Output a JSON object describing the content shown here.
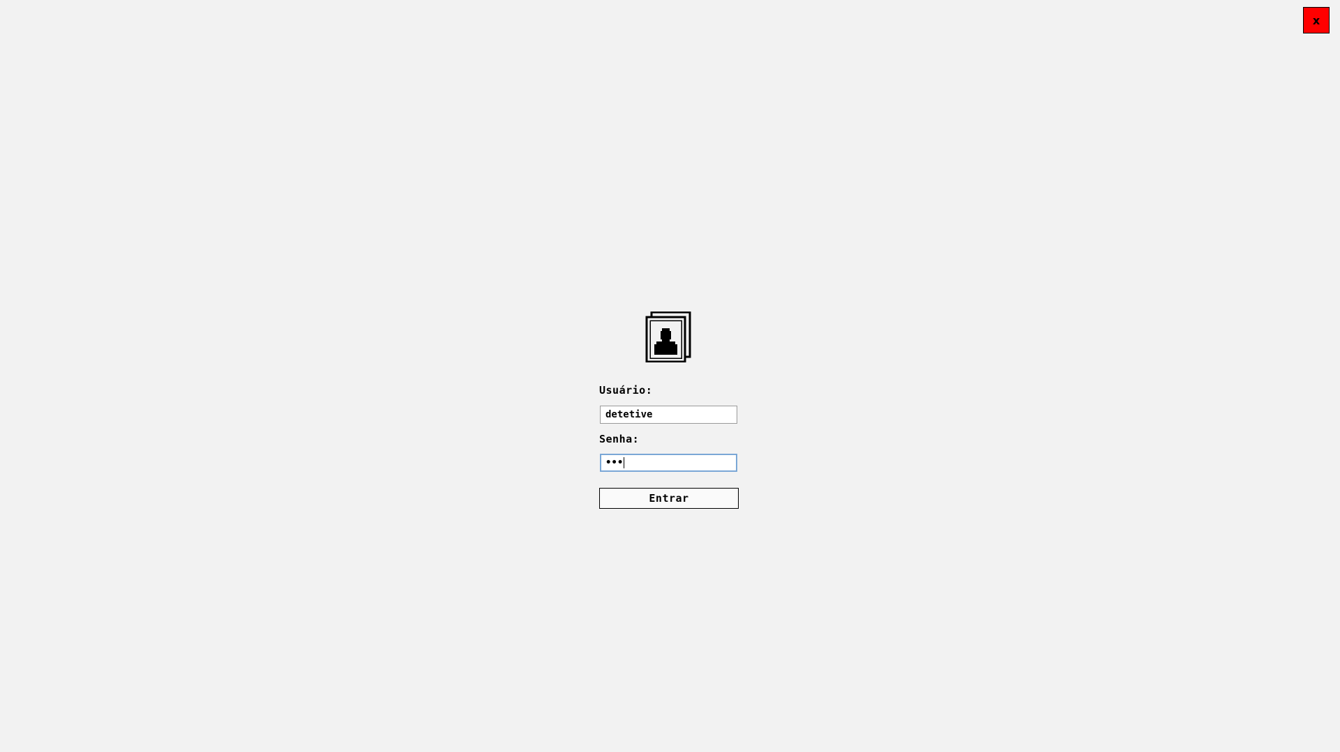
{
  "window": {
    "close_label": "x",
    "close_color": "#ff0000"
  },
  "login": {
    "icon": "user-profile-icon",
    "username_label": "Usuário:",
    "username_value": "detetive",
    "password_label": "Senha:",
    "password_masked": "•••",
    "submit_label": "Entrar"
  },
  "colors": {
    "background": "#f2f2f2",
    "focus_border": "#7aa7d6"
  }
}
